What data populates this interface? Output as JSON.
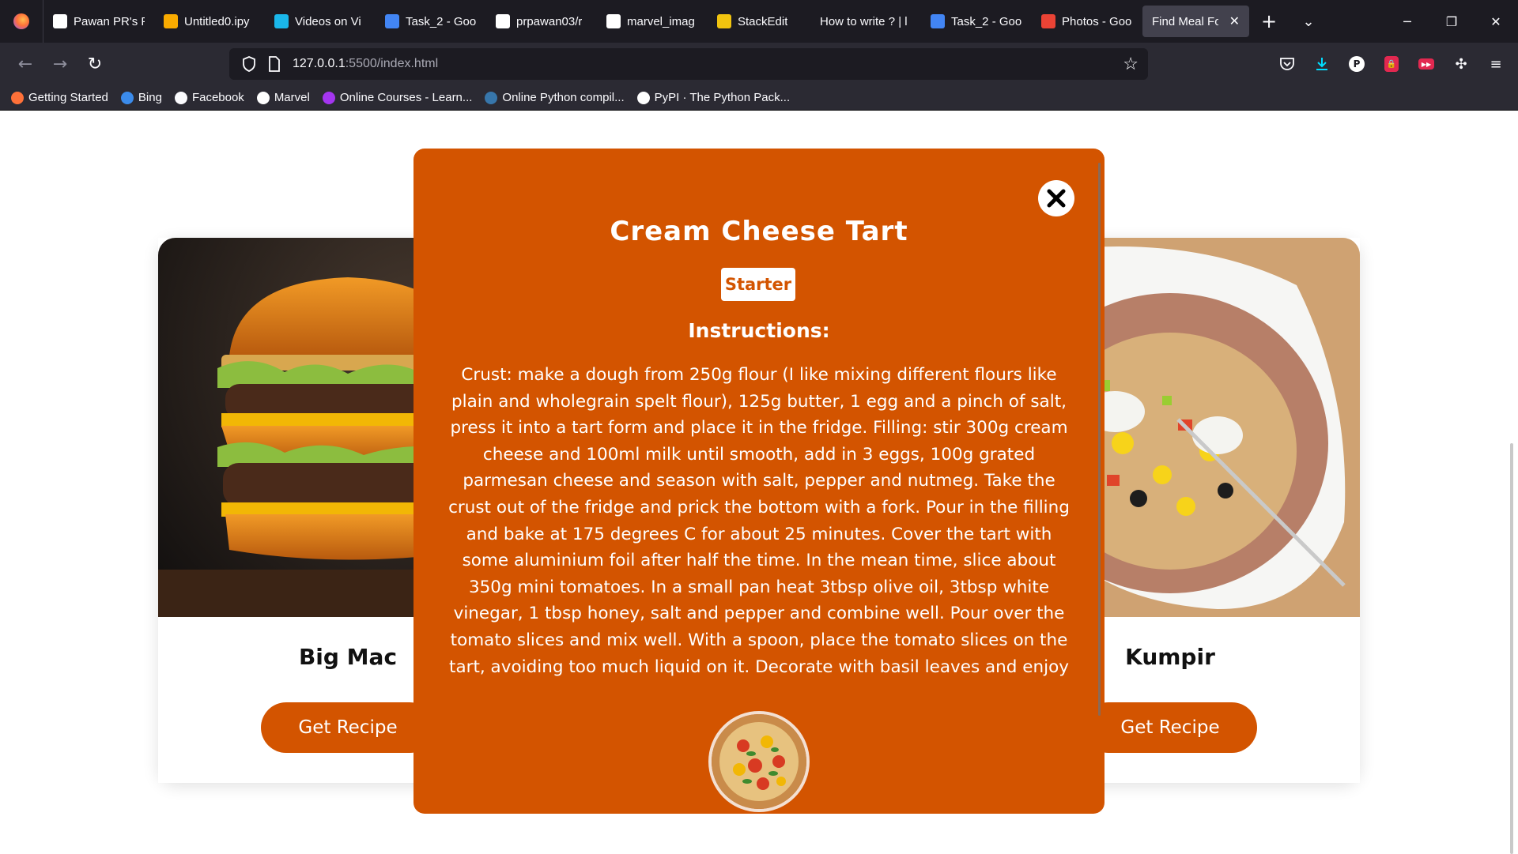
{
  "browser": {
    "tabs": [
      {
        "label": "Pawan PR's P",
        "favicon": "marvel-icon",
        "color": "#ffffff",
        "active": false
      },
      {
        "label": "Untitled0.ipy",
        "favicon": "colab-icon",
        "color": "#f9ab00",
        "active": false
      },
      {
        "label": "Videos on Vi",
        "favicon": "vimeo-icon",
        "color": "#1ab7ea",
        "active": false
      },
      {
        "label": "Task_2 - Goo",
        "favicon": "docs-icon",
        "color": "#4285f4",
        "active": false
      },
      {
        "label": "prpawan03/r",
        "favicon": "github-icon",
        "color": "#ffffff",
        "active": false
      },
      {
        "label": "marvel_imag",
        "favicon": "github-icon",
        "color": "#ffffff",
        "active": false
      },
      {
        "label": "StackEdit",
        "favicon": "stackedit-icon",
        "color": "#f1c40f",
        "active": false
      },
      {
        "label": "How to write ? | l",
        "favicon": "",
        "color": "#2b2a33",
        "active": false
      },
      {
        "label": "Task_2 - Goo",
        "favicon": "docs-icon",
        "color": "#4285f4",
        "active": false
      },
      {
        "label": "Photos - Goo",
        "favicon": "photos-icon",
        "color": "#ea4335",
        "active": false
      },
      {
        "label": "Find Meal For",
        "favicon": "",
        "color": "#42414d",
        "active": true
      }
    ],
    "url_host": "127.0.0.1",
    "url_rest": ":5500/index.html",
    "bookmarks": [
      {
        "label": "Getting Started",
        "icon": "firefox-icon",
        "color": "#ff7139"
      },
      {
        "label": "Bing",
        "icon": "search-icon",
        "color": "#3b8beb"
      },
      {
        "label": "Facebook",
        "icon": "globe-icon",
        "color": "#fbfbfe"
      },
      {
        "label": "Marvel",
        "icon": "marvel-icon",
        "color": "#ffffff"
      },
      {
        "label": "Online Courses - Learn...",
        "icon": "udemy-icon",
        "color": "#a435f0"
      },
      {
        "label": "Online Python compil...",
        "icon": "python-icon",
        "color": "#3776ab"
      },
      {
        "label": "PyPI · The Python Pack...",
        "icon": "pypi-icon",
        "color": "#ffffff"
      }
    ]
  },
  "page": {
    "cards": [
      {
        "title": "Big Mac",
        "button": "Get Recipe",
        "image": "burger-photo"
      },
      {
        "title": "Kumpir",
        "button": "Get Recipe",
        "image": "baked-potato-photo"
      }
    ],
    "popup": {
      "title": "Cream Cheese Tart",
      "category": "Starter",
      "instructions_heading": "Instructions:",
      "instructions": "Crust: make a dough from 250g flour (I like mixing different flours like plain and wholegrain spelt flour), 125g butter, 1 egg and a pinch of salt, press it into a tart form and place it in the fridge. Filling: stir 300g cream cheese and 100ml milk until smooth, add in 3 eggs, 100g grated parmesan cheese and season with salt, pepper and nutmeg. Take the crust out of the fridge and prick the bottom with a fork. Pour in the filling and bake at 175 degrees C for about 25 minutes. Cover the tart with some aluminium foil after half the time. In the mean time, slice about 350g mini tomatoes. In a small pan heat 3tbsp olive oil, 3tbsp white vinegar, 1 tbsp honey, salt and pepper and combine well. Pour over the tomato slices and mix well. With a spoon, place the tomato slices on the tart, avoiding too much liquid on it. Decorate with basil leaves and enjoy",
      "thumb": "tart-photo"
    },
    "accent": "#d35400"
  }
}
